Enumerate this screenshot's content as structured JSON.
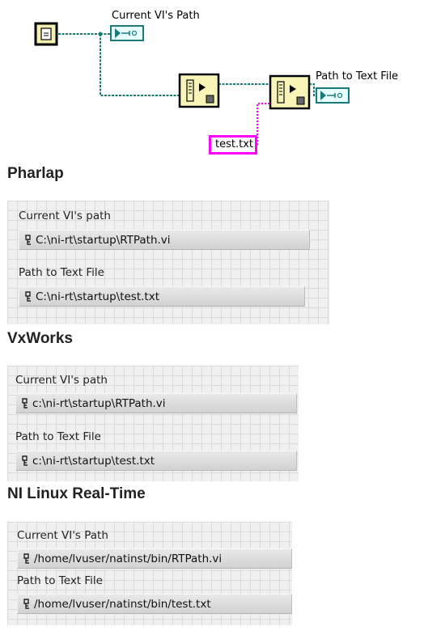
{
  "diagram": {
    "indicator_current_vi_path": "Current VI's Path",
    "indicator_path_to_text_file": "Path to Text File",
    "string_constant": "test.txt",
    "colors": {
      "path_wire": "#1a7a7a",
      "string_wire": "#ff00ff"
    }
  },
  "sections": [
    {
      "title": "Pharlap",
      "current_label": "Current VI's path",
      "current_value": "C:\\ni-rt\\startup\\RTPath.vi",
      "text_label": "Path to Text File",
      "text_value": "C:\\ni-rt\\startup\\test.txt"
    },
    {
      "title": "VxWorks",
      "current_label": "Current VI's path",
      "current_value": "c:\\ni-rt\\startup\\RTPath.vi",
      "text_label": "Path to Text File",
      "text_value": "c:\\ni-rt\\startup\\test.txt"
    },
    {
      "title": "NI Linux Real-Time",
      "current_label": "Current VI's Path",
      "current_value": "/home/lvuser/natinst/bin/RTPath.vi",
      "text_label": "Path to Text File",
      "text_value": "/home/lvuser/natinst/bin/test.txt"
    }
  ]
}
